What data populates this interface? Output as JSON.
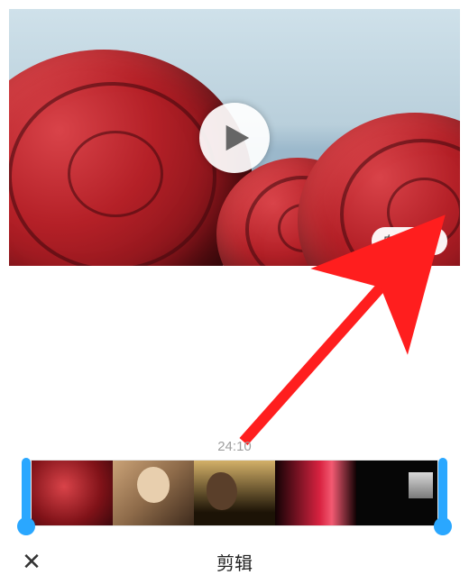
{
  "preview": {
    "auto_clip_label": "自动剪辑",
    "play_icon": "play-icon"
  },
  "timeline": {
    "duration_text": "24:10",
    "thumbnails": [
      "roses",
      "character-a",
      "character-b",
      "red-scene",
      "dark-scene"
    ]
  },
  "bottom": {
    "close_glyph": "✕",
    "title": "剪辑"
  },
  "annotation": {
    "arrow_color": "#ff1e1e"
  }
}
